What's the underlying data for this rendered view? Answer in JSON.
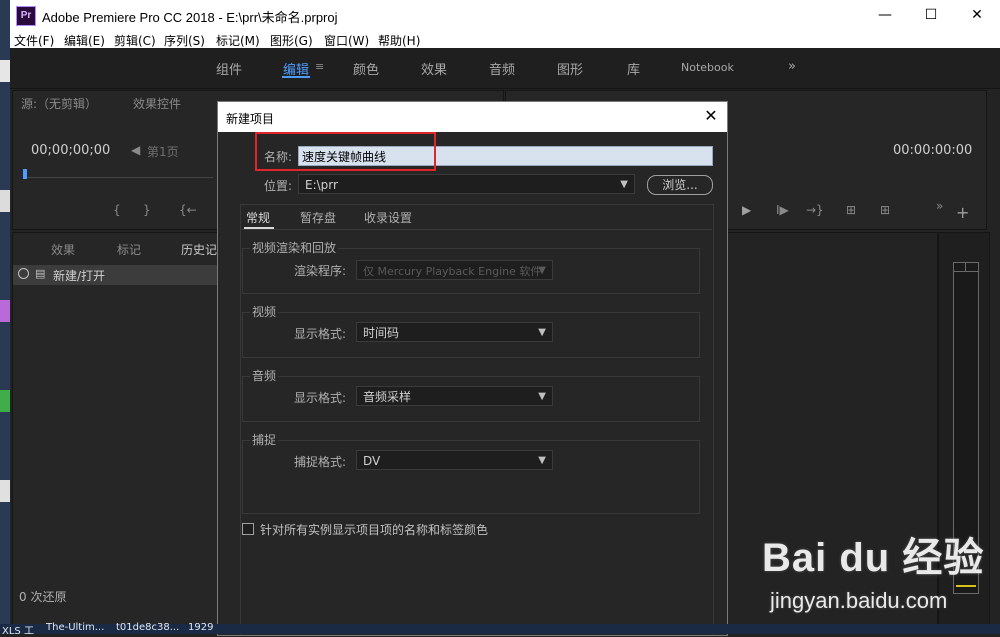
{
  "window": {
    "app_icon_text": "Pr",
    "title": "Adobe Premiere Pro CC 2018 - E:\\prr\\未命名.prproj",
    "minimize": "—",
    "maximize": "☐",
    "close": "✕"
  },
  "menu": [
    "文件(F)",
    "编辑(E)",
    "剪辑(C)",
    "序列(S)",
    "标记(M)",
    "图形(G)",
    "窗口(W)",
    "帮助(H)"
  ],
  "workspaces": {
    "tabs": [
      "组件",
      "编辑",
      "颜色",
      "效果",
      "音频",
      "图形",
      "库",
      "Notebook"
    ],
    "active": "编辑",
    "more": "»"
  },
  "source_panel": {
    "tabs": [
      "源:（无剪辑）",
      "效果控件"
    ],
    "timecode": "00;00;00;00",
    "page": "第1页"
  },
  "program_panel": {
    "timecode": "00:00:00:00"
  },
  "history_panel": {
    "tabs": [
      "效果",
      "标记",
      "历史记"
    ],
    "items": [
      "新建/打开"
    ],
    "footer": "0 次还原"
  },
  "dialog": {
    "title": "新建项目",
    "close": "✕",
    "name_label": "名称:",
    "name_value": "速度关键帧曲线",
    "location_label": "位置:",
    "location_value": "E:\\prr",
    "browse_label": "浏览...",
    "tabs": [
      "常规",
      "暂存盘",
      "收录设置"
    ],
    "active_tab": "常规",
    "groups": {
      "render": {
        "title": "视频渲染和回放",
        "renderer_label": "渲染程序:",
        "renderer_value": "仅 Mercury Playback Engine 软件"
      },
      "video": {
        "title": "视频",
        "format_label": "显示格式:",
        "format_value": "时间码"
      },
      "audio": {
        "title": "音频",
        "format_label": "显示格式:",
        "format_value": "音频采样"
      },
      "capture": {
        "title": "捕捉",
        "format_label": "捕捉格式:",
        "format_value": "DV"
      }
    },
    "checkbox_label": "针对所有实例显示项目项的名称和标签颜色"
  },
  "watermark": {
    "logo": "Bai du 经验",
    "url": "jingyan.baidu.com"
  },
  "taskbar": {
    "items": [
      "XLS 工",
      "The-Ultim...",
      "t01de8c38...",
      "1929"
    ]
  },
  "colors": {
    "accent": "#4f9cff",
    "highlight": "#e0262b",
    "panel_bg": "#262626"
  }
}
